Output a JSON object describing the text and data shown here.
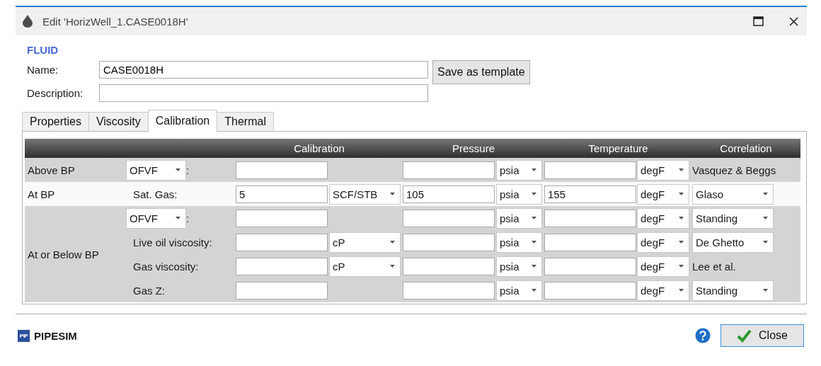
{
  "window": {
    "title": "Edit 'HorizWell_1.CASE0018H'"
  },
  "section_title": "FLUID",
  "name_field": {
    "label": "Name:",
    "value": "CASE0018H"
  },
  "save_button": "Save as template",
  "description_field": {
    "label": "Description:"
  },
  "tabs": [
    {
      "label": "Properties",
      "selected": false
    },
    {
      "label": "Viscosity",
      "selected": false
    },
    {
      "label": "Calibration",
      "selected": true
    },
    {
      "label": "Thermal",
      "selected": false
    }
  ],
  "table": {
    "columns": [
      "Calibration",
      "Pressure",
      "Temperature",
      "Correlation"
    ],
    "groups": [
      {
        "label": "Above BP",
        "rows": [
          {
            "param": {
              "kind": "combo",
              "value": "OFVF",
              "suffix": ":"
            },
            "calibration": "",
            "pressure": "",
            "pressure_unit": "psia",
            "temperature": "",
            "temperature_unit": "degF",
            "correlation": {
              "kind": "text",
              "value": "Vasquez & Beggs"
            }
          }
        ]
      },
      {
        "label": "At BP",
        "rows": [
          {
            "param": {
              "kind": "label",
              "value": "Sat. Gas:"
            },
            "calibration": "5",
            "calibration_unit": "SCF/STB",
            "pressure": "105",
            "pressure_unit": "psia",
            "temperature": "155",
            "temperature_unit": "degF",
            "correlation": {
              "kind": "combo",
              "value": "Glaso"
            }
          }
        ]
      },
      {
        "label": "At or Below BP",
        "rows": [
          {
            "param": {
              "kind": "combo",
              "value": "OFVF",
              "suffix": ":"
            },
            "calibration": "",
            "pressure": "",
            "pressure_unit": "psia",
            "temperature": "",
            "temperature_unit": "degF",
            "correlation": {
              "kind": "combo",
              "value": "Standing"
            }
          },
          {
            "param": {
              "kind": "label",
              "value": "Live oil viscosity:"
            },
            "calibration": "",
            "calibration_unit": "cP",
            "pressure": "",
            "pressure_unit": "psia",
            "temperature": "",
            "temperature_unit": "degF",
            "correlation": {
              "kind": "combo",
              "value": "De Ghetto"
            }
          },
          {
            "param": {
              "kind": "label",
              "value": "Gas viscosity:"
            },
            "calibration": "",
            "calibration_unit": "cP",
            "pressure": "",
            "pressure_unit": "psia",
            "temperature": "",
            "temperature_unit": "degF",
            "correlation": {
              "kind": "text",
              "value": "Lee et al."
            }
          },
          {
            "param": {
              "kind": "label",
              "value": "Gas Z:"
            },
            "calibration": "",
            "pressure": "",
            "pressure_unit": "psia",
            "temperature": "",
            "temperature_unit": "degF",
            "correlation": {
              "kind": "combo",
              "value": "Standing"
            }
          }
        ]
      }
    ]
  },
  "footer": {
    "logo_mark": "PIP",
    "brand": "PIPESIM",
    "close_button": "Close"
  }
}
